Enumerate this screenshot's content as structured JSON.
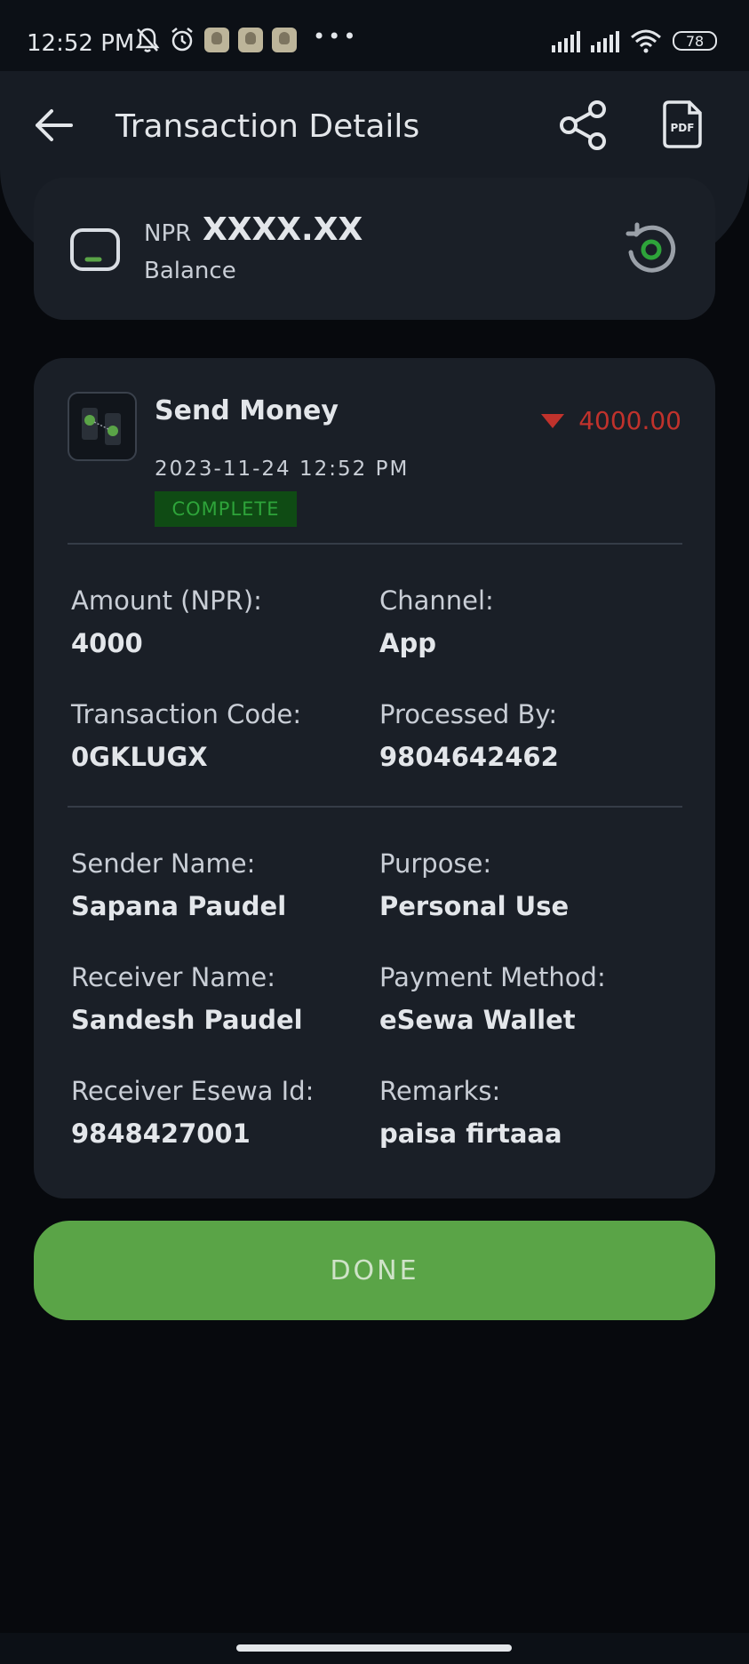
{
  "status_bar": {
    "time": "12:52 PM",
    "battery": "78"
  },
  "header": {
    "title": "Transaction Details"
  },
  "balance": {
    "currency": "NPR",
    "value": "XXXX.XX",
    "label": "Balance"
  },
  "transaction": {
    "type": "Send Money",
    "amount": "4000.00",
    "datetime": "2023-11-24 12:52 PM",
    "status": "COMPLETE",
    "fields": {
      "amount_label": "Amount (NPR):",
      "amount_value": "4000",
      "channel_label": "Channel:",
      "channel_value": "App",
      "code_label": "Transaction Code:",
      "code_value": "0GKLUGX",
      "processed_label": "Processed By:",
      "processed_value": "9804642462",
      "sender_label": "Sender Name:",
      "sender_value": "Sapana Paudel",
      "purpose_label": "Purpose:",
      "purpose_value": "Personal Use",
      "receiver_label": "Receiver Name:",
      "receiver_value": "Sandesh Paudel",
      "method_label": "Payment Method:",
      "method_value": "eSewa Wallet",
      "esewa_id_label": "Receiver Esewa Id:",
      "esewa_id_value": "9848427001",
      "remarks_label": "Remarks:",
      "remarks_value": "paisa firtaaa"
    }
  },
  "actions": {
    "done_label": "DONE"
  },
  "colors": {
    "accent_green": "#5aa447",
    "debit_red": "#c0322c",
    "complete_green": "#2ea43a"
  }
}
